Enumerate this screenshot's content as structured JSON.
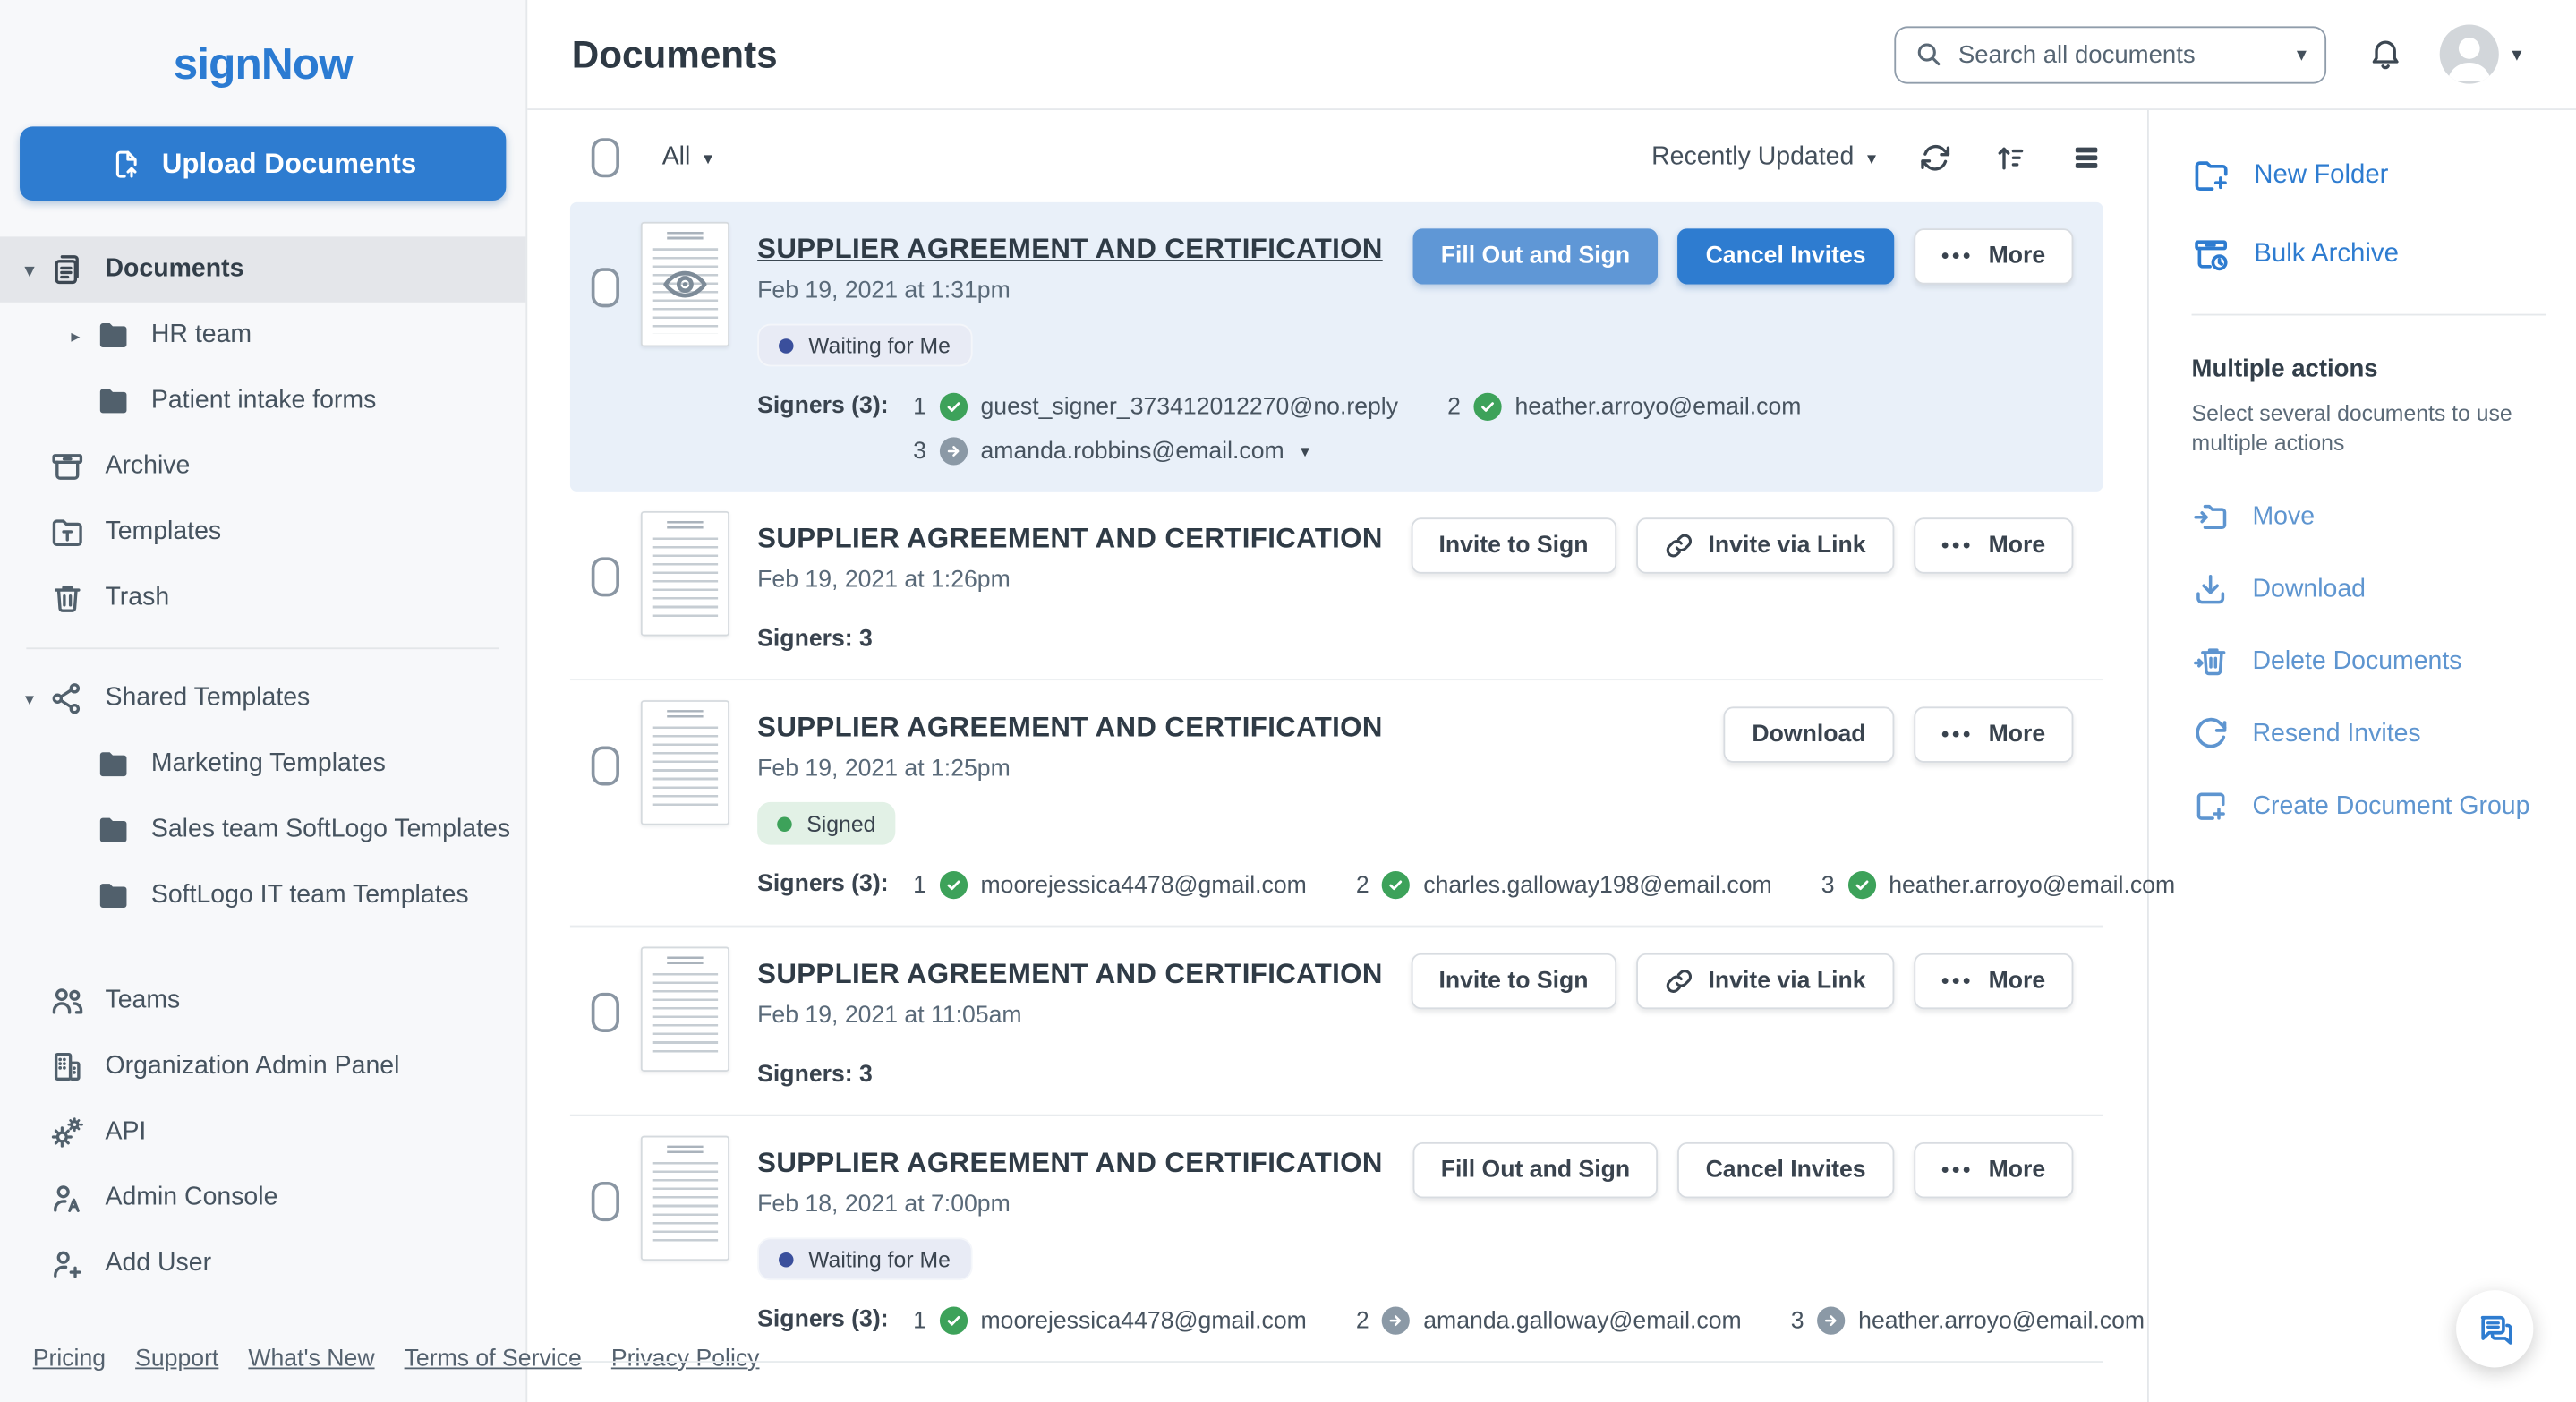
{
  "sidebar": {
    "logo": "signNow",
    "upload_label": "Upload Documents",
    "sections": [
      {
        "items": [
          {
            "label": "Documents",
            "icon": "documents-icon",
            "caret": "down",
            "selected": true
          },
          {
            "label": "HR team",
            "icon": "folder-icon",
            "caret": "right",
            "indent": true
          },
          {
            "label": "Patient intake forms",
            "icon": "folder-icon",
            "indent": true
          },
          {
            "label": "Archive",
            "icon": "archive-icon"
          },
          {
            "label": "Templates",
            "icon": "templates-icon"
          },
          {
            "label": "Trash",
            "icon": "trash-icon"
          }
        ]
      },
      {
        "items": [
          {
            "label": "Shared Templates",
            "icon": "shared-templates-icon",
            "caret": "down"
          },
          {
            "label": "Marketing Templates",
            "icon": "folder-icon",
            "indent": true
          },
          {
            "label": "Sales team SoftLogo Templates",
            "icon": "folder-icon",
            "indent": true
          },
          {
            "label": "SoftLogo IT team Templates",
            "icon": "folder-icon",
            "indent": true
          }
        ]
      },
      {
        "items": [
          {
            "label": "Teams",
            "icon": "teams-icon"
          },
          {
            "label": "Organization Admin Panel",
            "icon": "organization-icon"
          },
          {
            "label": "API",
            "icon": "api-icon"
          },
          {
            "label": "Admin Console",
            "icon": "admin-console-icon"
          },
          {
            "label": "Add User",
            "icon": "add-user-icon"
          }
        ]
      }
    ],
    "footer_links": [
      "Pricing",
      "Support",
      "What's New",
      "Terms of Service",
      "Privacy Policy"
    ]
  },
  "header": {
    "title": "Documents",
    "search_placeholder": "Search all documents"
  },
  "toolbar": {
    "filter_label": "All",
    "sort_label": "Recently Updated"
  },
  "documents": [
    {
      "title": "SUPPLIER AGREEMENT AND CERTIFICATION",
      "title_underlined": true,
      "selected": true,
      "thumbnail_overlay": "eye-icon",
      "date": "Feb 19, 2021 at 1:31pm",
      "badge": {
        "label": "Waiting for Me",
        "type": "waiting"
      },
      "buttons": [
        {
          "label": "Fill Out and Sign",
          "style": "solid-light"
        },
        {
          "label": "Cancel Invites",
          "style": "solid"
        },
        {
          "label": "More",
          "style": "outline",
          "dots": true
        }
      ],
      "signers_label": "Signers (3):",
      "signer_lines": [
        [
          {
            "n": "1",
            "status": "signed",
            "email": "guest_signer_373412012270@no.reply"
          },
          {
            "n": "2",
            "status": "signed",
            "email": "heather.arroyo@email.com"
          }
        ],
        [
          {
            "n": "3",
            "status": "pending",
            "email": "amanda.robbins@email.com",
            "caret": true
          }
        ]
      ]
    },
    {
      "title": "SUPPLIER AGREEMENT AND CERTIFICATION",
      "date": "Feb 19, 2021 at 1:26pm",
      "buttons": [
        {
          "label": "Invite to Sign",
          "style": "outline"
        },
        {
          "label": "Invite via Link",
          "style": "outline",
          "icon": "link-icon"
        },
        {
          "label": "More",
          "style": "outline",
          "dots": true
        }
      ],
      "signers_summary": "Signers: 3"
    },
    {
      "title": "SUPPLIER AGREEMENT AND CERTIFICATION",
      "date": "Feb 19, 2021 at 1:25pm",
      "badge": {
        "label": "Signed",
        "type": "signed"
      },
      "buttons": [
        {
          "label": "Download",
          "style": "outline"
        },
        {
          "label": "More",
          "style": "outline",
          "dots": true
        }
      ],
      "signers_label": "Signers (3):",
      "signer_lines": [
        [
          {
            "n": "1",
            "status": "signed",
            "email": "moorejessica4478@gmail.com"
          },
          {
            "n": "2",
            "status": "signed",
            "email": "charles.galloway198@email.com"
          },
          {
            "n": "3",
            "status": "signed",
            "email": "heather.arroyo@email.com"
          }
        ]
      ]
    },
    {
      "title": "SUPPLIER AGREEMENT AND CERTIFICATION",
      "date": "Feb 19, 2021 at 11:05am",
      "buttons": [
        {
          "label": "Invite to Sign",
          "style": "outline"
        },
        {
          "label": "Invite via Link",
          "style": "outline",
          "icon": "link-icon"
        },
        {
          "label": "More",
          "style": "outline",
          "dots": true
        }
      ],
      "signers_summary": "Signers: 3"
    },
    {
      "title": "SUPPLIER AGREEMENT AND CERTIFICATION",
      "date": "Feb 18, 2021 at 7:00pm",
      "badge": {
        "label": "Waiting for Me",
        "type": "waiting"
      },
      "buttons": [
        {
          "label": "Fill Out and Sign",
          "style": "outline"
        },
        {
          "label": "Cancel Invites",
          "style": "outline"
        },
        {
          "label": "More",
          "style": "outline",
          "dots": true
        }
      ],
      "signers_label": "Signers (3):",
      "signer_lines": [
        [
          {
            "n": "1",
            "status": "signed",
            "email": "moorejessica4478@gmail.com"
          },
          {
            "n": "2",
            "status": "pending",
            "email": "amanda.galloway@email.com"
          },
          {
            "n": "3",
            "status": "pending",
            "email": "heather.arroyo@email.com"
          }
        ]
      ]
    }
  ],
  "right_panel": {
    "primary_actions": [
      {
        "label": "New Folder",
        "icon": "new-folder-icon"
      },
      {
        "label": "Bulk Archive",
        "icon": "bulk-archive-icon"
      }
    ],
    "title": "Multiple actions",
    "hint": "Select several documents to use multiple actions",
    "actions": [
      {
        "label": "Move",
        "icon": "move-icon"
      },
      {
        "label": "Download",
        "icon": "download-icon"
      },
      {
        "label": "Delete Documents",
        "icon": "delete-documents-icon"
      },
      {
        "label": "Resend Invites",
        "icon": "resend-invites-icon"
      },
      {
        "label": "Create Document Group",
        "icon": "create-document-group-icon"
      }
    ]
  },
  "colors": {
    "accent": "#2e7cd0",
    "accent_light": "#5f97d6",
    "signed_green": "#3da25a",
    "pending_gray": "#8b99a6",
    "waiting_dot": "#3a4f9c",
    "selected_row_bg": "#e9f0f9"
  }
}
